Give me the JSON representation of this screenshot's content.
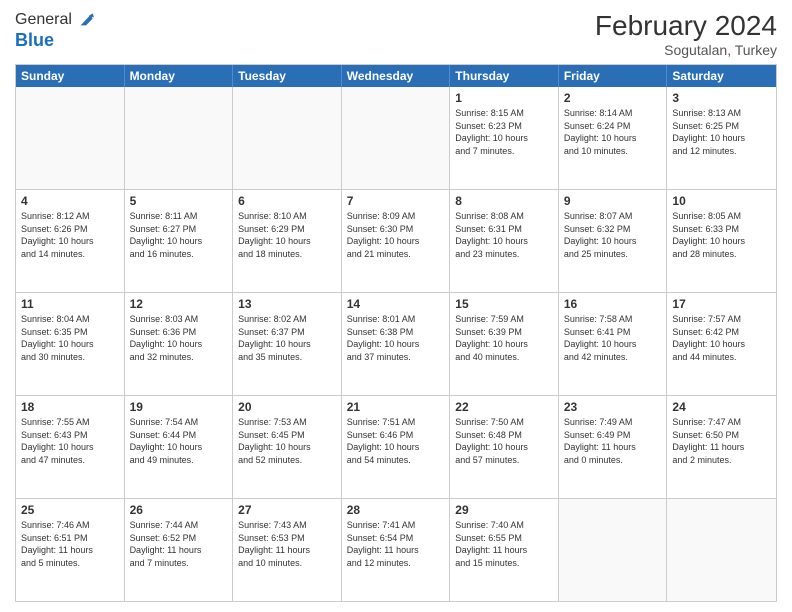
{
  "header": {
    "logo_line1": "General",
    "logo_line2": "Blue",
    "title": "February 2024",
    "location": "Sogutalan, Turkey"
  },
  "days_of_week": [
    "Sunday",
    "Monday",
    "Tuesday",
    "Wednesday",
    "Thursday",
    "Friday",
    "Saturday"
  ],
  "weeks": [
    [
      {
        "day": "",
        "info": ""
      },
      {
        "day": "",
        "info": ""
      },
      {
        "day": "",
        "info": ""
      },
      {
        "day": "",
        "info": ""
      },
      {
        "day": "1",
        "info": "Sunrise: 8:15 AM\nSunset: 6:23 PM\nDaylight: 10 hours\nand 7 minutes."
      },
      {
        "day": "2",
        "info": "Sunrise: 8:14 AM\nSunset: 6:24 PM\nDaylight: 10 hours\nand 10 minutes."
      },
      {
        "day": "3",
        "info": "Sunrise: 8:13 AM\nSunset: 6:25 PM\nDaylight: 10 hours\nand 12 minutes."
      }
    ],
    [
      {
        "day": "4",
        "info": "Sunrise: 8:12 AM\nSunset: 6:26 PM\nDaylight: 10 hours\nand 14 minutes."
      },
      {
        "day": "5",
        "info": "Sunrise: 8:11 AM\nSunset: 6:27 PM\nDaylight: 10 hours\nand 16 minutes."
      },
      {
        "day": "6",
        "info": "Sunrise: 8:10 AM\nSunset: 6:29 PM\nDaylight: 10 hours\nand 18 minutes."
      },
      {
        "day": "7",
        "info": "Sunrise: 8:09 AM\nSunset: 6:30 PM\nDaylight: 10 hours\nand 21 minutes."
      },
      {
        "day": "8",
        "info": "Sunrise: 8:08 AM\nSunset: 6:31 PM\nDaylight: 10 hours\nand 23 minutes."
      },
      {
        "day": "9",
        "info": "Sunrise: 8:07 AM\nSunset: 6:32 PM\nDaylight: 10 hours\nand 25 minutes."
      },
      {
        "day": "10",
        "info": "Sunrise: 8:05 AM\nSunset: 6:33 PM\nDaylight: 10 hours\nand 28 minutes."
      }
    ],
    [
      {
        "day": "11",
        "info": "Sunrise: 8:04 AM\nSunset: 6:35 PM\nDaylight: 10 hours\nand 30 minutes."
      },
      {
        "day": "12",
        "info": "Sunrise: 8:03 AM\nSunset: 6:36 PM\nDaylight: 10 hours\nand 32 minutes."
      },
      {
        "day": "13",
        "info": "Sunrise: 8:02 AM\nSunset: 6:37 PM\nDaylight: 10 hours\nand 35 minutes."
      },
      {
        "day": "14",
        "info": "Sunrise: 8:01 AM\nSunset: 6:38 PM\nDaylight: 10 hours\nand 37 minutes."
      },
      {
        "day": "15",
        "info": "Sunrise: 7:59 AM\nSunset: 6:39 PM\nDaylight: 10 hours\nand 40 minutes."
      },
      {
        "day": "16",
        "info": "Sunrise: 7:58 AM\nSunset: 6:41 PM\nDaylight: 10 hours\nand 42 minutes."
      },
      {
        "day": "17",
        "info": "Sunrise: 7:57 AM\nSunset: 6:42 PM\nDaylight: 10 hours\nand 44 minutes."
      }
    ],
    [
      {
        "day": "18",
        "info": "Sunrise: 7:55 AM\nSunset: 6:43 PM\nDaylight: 10 hours\nand 47 minutes."
      },
      {
        "day": "19",
        "info": "Sunrise: 7:54 AM\nSunset: 6:44 PM\nDaylight: 10 hours\nand 49 minutes."
      },
      {
        "day": "20",
        "info": "Sunrise: 7:53 AM\nSunset: 6:45 PM\nDaylight: 10 hours\nand 52 minutes."
      },
      {
        "day": "21",
        "info": "Sunrise: 7:51 AM\nSunset: 6:46 PM\nDaylight: 10 hours\nand 54 minutes."
      },
      {
        "day": "22",
        "info": "Sunrise: 7:50 AM\nSunset: 6:48 PM\nDaylight: 10 hours\nand 57 minutes."
      },
      {
        "day": "23",
        "info": "Sunrise: 7:49 AM\nSunset: 6:49 PM\nDaylight: 11 hours\nand 0 minutes."
      },
      {
        "day": "24",
        "info": "Sunrise: 7:47 AM\nSunset: 6:50 PM\nDaylight: 11 hours\nand 2 minutes."
      }
    ],
    [
      {
        "day": "25",
        "info": "Sunrise: 7:46 AM\nSunset: 6:51 PM\nDaylight: 11 hours\nand 5 minutes."
      },
      {
        "day": "26",
        "info": "Sunrise: 7:44 AM\nSunset: 6:52 PM\nDaylight: 11 hours\nand 7 minutes."
      },
      {
        "day": "27",
        "info": "Sunrise: 7:43 AM\nSunset: 6:53 PM\nDaylight: 11 hours\nand 10 minutes."
      },
      {
        "day": "28",
        "info": "Sunrise: 7:41 AM\nSunset: 6:54 PM\nDaylight: 11 hours\nand 12 minutes."
      },
      {
        "day": "29",
        "info": "Sunrise: 7:40 AM\nSunset: 6:55 PM\nDaylight: 11 hours\nand 15 minutes."
      },
      {
        "day": "",
        "info": ""
      },
      {
        "day": "",
        "info": ""
      }
    ]
  ]
}
